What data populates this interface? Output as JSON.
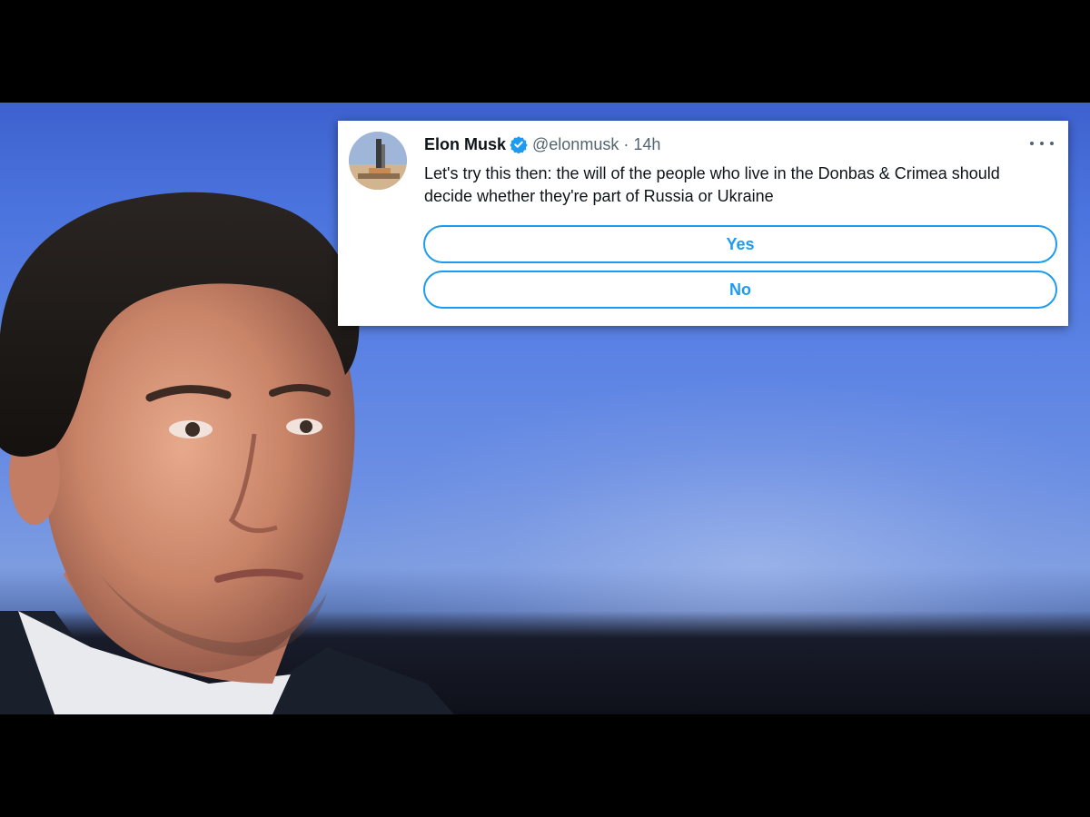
{
  "tweet": {
    "display_name": "Elon Musk",
    "verified_icon": "verified-badge-icon",
    "handle": "@elonmusk",
    "separator": "·",
    "time": "14h",
    "text": "Let's try this then: the will of the people who live in the Donbas & Crimea should decide whether they're part of Russia or Ukraine",
    "more_icon": "more-options-icon",
    "poll": {
      "options": [
        "Yes",
        "No"
      ]
    }
  },
  "colors": {
    "accent": "#1d9bf0",
    "text_primary": "#0f1419",
    "text_secondary": "#536471",
    "background_blue": "#4c74de"
  }
}
